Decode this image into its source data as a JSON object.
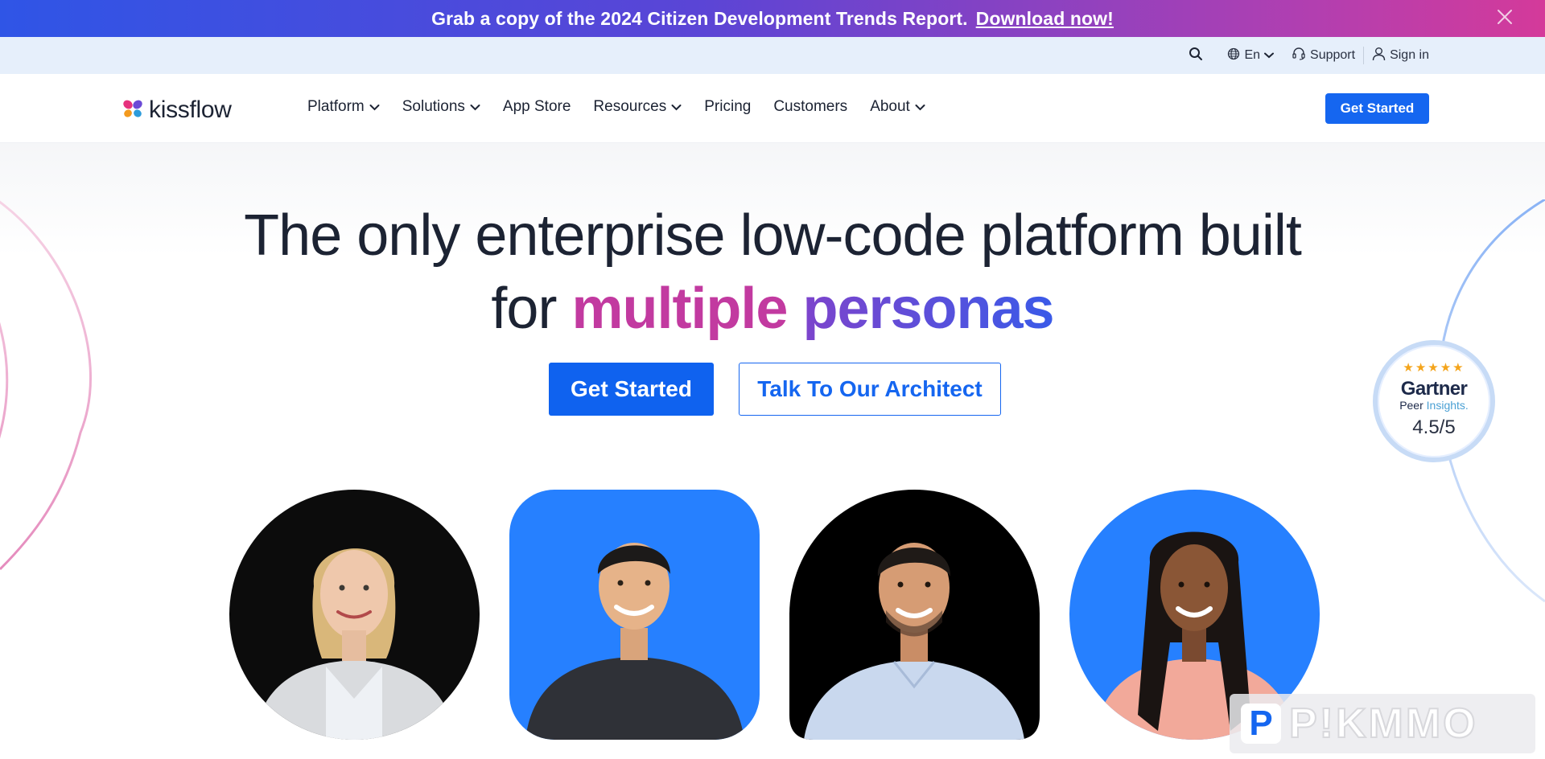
{
  "announcement": {
    "text": "Grab a copy of the 2024 Citizen Development Trends Report.",
    "link_text": "Download now!"
  },
  "utility": {
    "language": "En",
    "support": "Support",
    "signin": "Sign in"
  },
  "nav": {
    "logo_text": "kissflow",
    "items": [
      {
        "label": "Platform",
        "dropdown": true
      },
      {
        "label": "Solutions",
        "dropdown": true
      },
      {
        "label": "App Store",
        "dropdown": false
      },
      {
        "label": "Resources",
        "dropdown": true
      },
      {
        "label": "Pricing",
        "dropdown": false
      },
      {
        "label": "Customers",
        "dropdown": false
      },
      {
        "label": "About",
        "dropdown": true
      }
    ],
    "cta": "Get Started"
  },
  "hero": {
    "line1": "The only enterprise low-code platform built",
    "line2_prefix": "for",
    "line2_word1": "multiple",
    "line2_word2": "personas",
    "primary_cta": "Get Started",
    "secondary_cta": "Talk To Our Architect"
  },
  "badge": {
    "brand": "Gartner",
    "sub_peer": "Peer",
    "sub_insights": "Insights.",
    "stars": "★★★★★",
    "score": "4.5/5"
  },
  "colors": {
    "primary": "#1566f0",
    "magenta": "#c23aa0",
    "purple": "#7d44cc",
    "persona_blue": "#2680ff",
    "persona_black": "#0c0c0c"
  },
  "watermark": {
    "p": "P",
    "text": "P!KMMO"
  }
}
